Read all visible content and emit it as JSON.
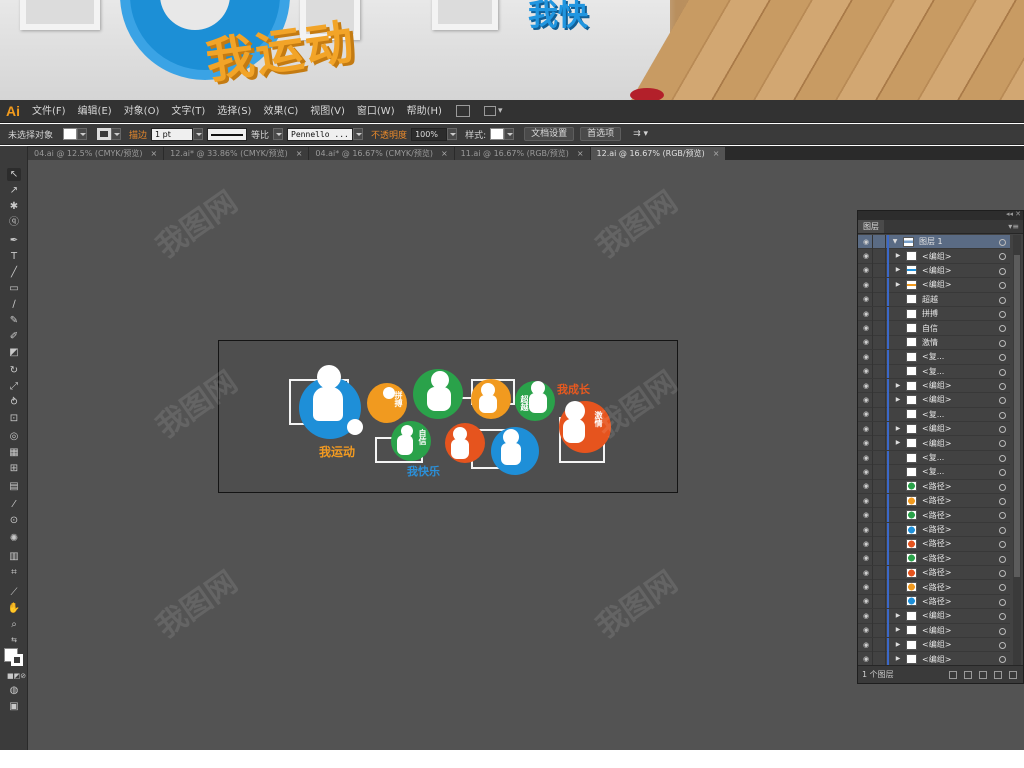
{
  "banner": {
    "gold_text": "我运动",
    "blue_text": "我快"
  },
  "app": {
    "logo": "Ai",
    "menus": [
      "文件(F)",
      "编辑(E)",
      "对象(O)",
      "文字(T)",
      "选择(S)",
      "效果(C)",
      "视图(V)",
      "窗口(W)",
      "帮助(H)"
    ]
  },
  "control": {
    "selection": "未选择对象",
    "stroke_label": "描边",
    "stroke_weight": "1 pt",
    "stroke_profile": "等比",
    "brush": "Pennello ...",
    "opacity_label": "不透明度",
    "opacity": "100%",
    "style_label": "样式:",
    "doc_setup": "文档设置",
    "preferences": "首选项"
  },
  "tabs": [
    {
      "label": "04.ai @ 12.5% (CMYK/预览)",
      "active": false
    },
    {
      "label": "12.ai* @ 33.86% (CMYK/预览)",
      "active": false
    },
    {
      "label": "04.ai* @ 16.67% (CMYK/预览)",
      "active": false
    },
    {
      "label": "11.ai @ 16.67% (RGB/预览)",
      "active": false
    },
    {
      "label": "12.ai @ 16.67% (RGB/预览)",
      "active": true
    }
  ],
  "artwork": {
    "labels": {
      "sport": "我运动",
      "grow": "我成长",
      "happy": "我快乐",
      "pinbo": "拼搏",
      "zixin": "自信",
      "chaoyue": "超越",
      "jiqing": "激情"
    },
    "colors": {
      "blue": "#1e8fd8",
      "orange": "#f19a1f",
      "green": "#2aa24a",
      "red": "#e6541e",
      "label_orange": "#f29a21",
      "label_blue": "#2b90d9",
      "label_red": "#e8591f"
    }
  },
  "layers": {
    "tab": "图层",
    "count": "1 个图层",
    "rows": [
      {
        "name": "图层 1",
        "arrow": "open",
        "thumb": "layer",
        "first": true
      },
      {
        "name": "<编组>",
        "arrow": "closed",
        "thumb": "white"
      },
      {
        "name": "<编组>",
        "arrow": "closed",
        "thumb": "blue-text"
      },
      {
        "name": "<编组>",
        "arrow": "closed",
        "thumb": "orange-text"
      },
      {
        "name": "超越",
        "arrow": "",
        "thumb": "white"
      },
      {
        "name": "拼搏",
        "arrow": "",
        "thumb": "white"
      },
      {
        "name": "自信",
        "arrow": "",
        "thumb": "white"
      },
      {
        "name": "激情",
        "arrow": "",
        "thumb": "white"
      },
      {
        "name": "<复...",
        "arrow": "",
        "thumb": "white"
      },
      {
        "name": "<复...",
        "arrow": "",
        "thumb": "white"
      },
      {
        "name": "<编组>",
        "arrow": "closed",
        "thumb": "white"
      },
      {
        "name": "<编组>",
        "arrow": "closed",
        "thumb": "white"
      },
      {
        "name": "<复...",
        "arrow": "",
        "thumb": "white"
      },
      {
        "name": "<编组>",
        "arrow": "closed",
        "thumb": "white"
      },
      {
        "name": "<编组>",
        "arrow": "closed",
        "thumb": "white"
      },
      {
        "name": "<复...",
        "arrow": "",
        "thumb": "white"
      },
      {
        "name": "<复...",
        "arrow": "",
        "thumb": "white"
      },
      {
        "name": "<路径>",
        "arrow": "",
        "thumb": "green"
      },
      {
        "name": "<路径>",
        "arrow": "",
        "thumb": "orange"
      },
      {
        "name": "<路径>",
        "arrow": "",
        "thumb": "green"
      },
      {
        "name": "<路径>",
        "arrow": "",
        "thumb": "blue"
      },
      {
        "name": "<路径>",
        "arrow": "",
        "thumb": "red"
      },
      {
        "name": "<路径>",
        "arrow": "",
        "thumb": "green"
      },
      {
        "name": "<路径>",
        "arrow": "",
        "thumb": "red"
      },
      {
        "name": "<路径>",
        "arrow": "",
        "thumb": "orange"
      },
      {
        "name": "<路径>",
        "arrow": "",
        "thumb": "blue"
      },
      {
        "name": "<编组>",
        "arrow": "closed",
        "thumb": "white"
      },
      {
        "name": "<编组>",
        "arrow": "closed",
        "thumb": "white"
      },
      {
        "name": "<编组>",
        "arrow": "closed",
        "thumb": "white"
      },
      {
        "name": "<编组>",
        "arrow": "closed",
        "thumb": "white"
      }
    ]
  }
}
